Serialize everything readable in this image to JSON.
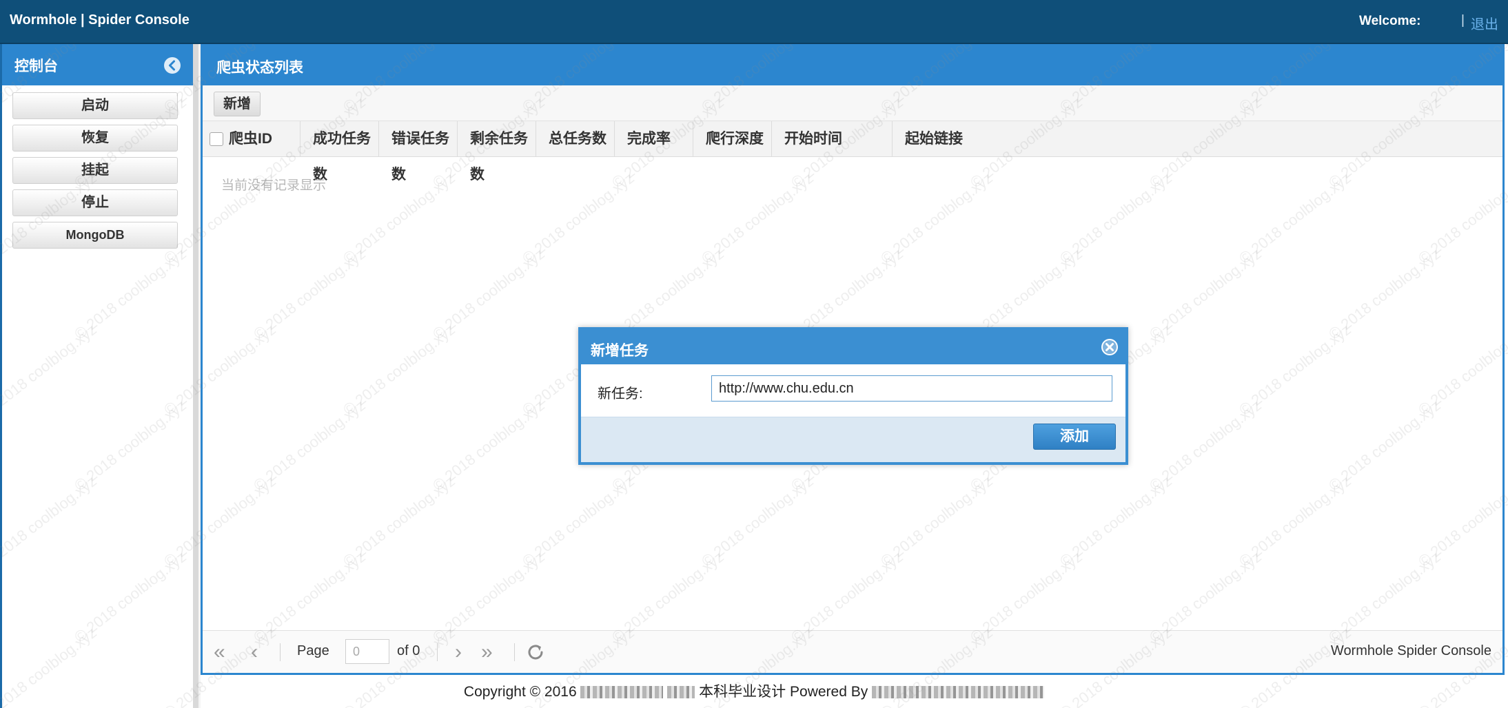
{
  "header": {
    "title": "Wormhole | Spider Console",
    "welcome": "Welcome:",
    "separator": "|",
    "logout": "退出"
  },
  "sidebar": {
    "title": "控制台",
    "buttons": [
      "启动",
      "恢复",
      "挂起",
      "停止",
      "MongoDB"
    ]
  },
  "main": {
    "title": "爬虫状态列表",
    "add_label": "新增",
    "columns": [
      "爬虫ID",
      "成功任务数",
      "错误任务数",
      "剩余任务数",
      "总任务数",
      "完成率",
      "爬行深度",
      "开始时间",
      "起始链接"
    ],
    "empty_text": "当前没有记录显示"
  },
  "pager": {
    "page_label": "Page",
    "page_value": "0",
    "of_label": "of 0",
    "brand": "Wormhole Spider Console"
  },
  "footer": {
    "prefix": "Copyright © 2016",
    "middle": "本科毕业设计 Powered By"
  },
  "watermark": "© 2018 coolblog.xyz",
  "modal": {
    "title": "新增任务",
    "field_label": "新任务:",
    "field_value": "http://www.chu.edu.cn",
    "submit_label": "添加"
  },
  "colors": {
    "header_bg": "#0f4f79",
    "panel_header": "#2c86cf",
    "modal_header": "#3b8fd2",
    "logout_link": "#6ab1ea"
  }
}
